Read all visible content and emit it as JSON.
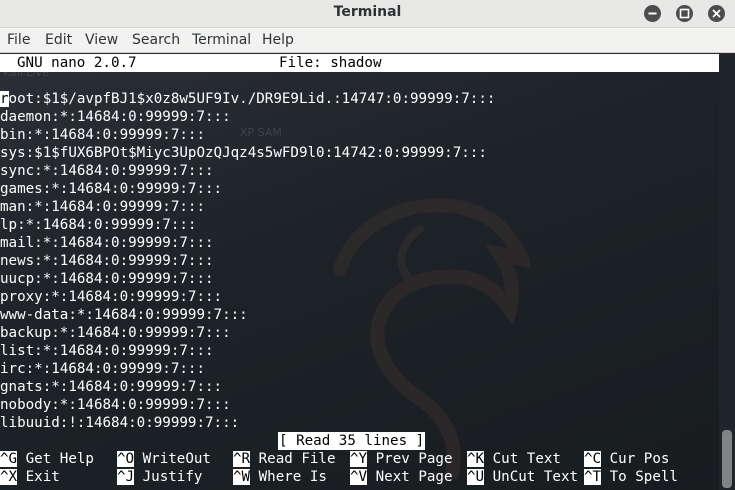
{
  "window": {
    "title": "Terminal"
  },
  "menu": [
    "File",
    "Edit",
    "View",
    "Search",
    "Terminal",
    "Help"
  ],
  "nano": {
    "version": "GNU nano 2.0.7",
    "file_label": "File: shadow",
    "cursor_char": "r",
    "lines": [
      "oot:$1$/avpfBJ1$x0z8w5UF9Iv./DR9E9Lid.:14747:0:99999:7:::",
      "daemon:*:14684:0:99999:7:::",
      "bin:*:14684:0:99999:7:::",
      "sys:$1$fUX6BPOt$Miyc3UpOzQJqz4s5wFD9l0:14742:0:99999:7:::",
      "sync:*:14684:0:99999:7:::",
      "games:*:14684:0:99999:7:::",
      "man:*:14684:0:99999:7:::",
      "lp:*:14684:0:99999:7:::",
      "mail:*:14684:0:99999:7:::",
      "news:*:14684:0:99999:7:::",
      "uucp:*:14684:0:99999:7:::",
      "proxy:*:14684:0:99999:7:::",
      "www-data:*:14684:0:99999:7:::",
      "backup:*:14684:0:99999:7:::",
      "list:*:14684:0:99999:7:::",
      "irc:*:14684:0:99999:7:::",
      "gnats:*:14684:0:99999:7:::",
      "nobody:*:14684:0:99999:7:::",
      "libuuid:!:14684:0:99999:7:::"
    ],
    "status": "[ Read 35 lines ]",
    "shortcuts_row1": [
      {
        "key": "^G",
        "label": " Get Help"
      },
      {
        "key": "^O",
        "label": " WriteOut"
      },
      {
        "key": "^R",
        "label": " Read File"
      },
      {
        "key": "^Y",
        "label": " Prev Page"
      },
      {
        "key": "^K",
        "label": " Cut Text"
      },
      {
        "key": "^C",
        "label": " Cur Pos"
      }
    ],
    "shortcuts_row2": [
      {
        "key": "^X",
        "label": " Exit"
      },
      {
        "key": "^J",
        "label": " Justify"
      },
      {
        "key": "^W",
        "label": " Where Is"
      },
      {
        "key": "^V",
        "label": " Next Page"
      },
      {
        "key": "^U",
        "label": " UnCut Text"
      },
      {
        "key": "^T",
        "label": " To Spell"
      }
    ]
  },
  "background": {
    "wallpaper_text_top": "Kali Live",
    "wallpaper_text_mid": "XP SAM"
  }
}
